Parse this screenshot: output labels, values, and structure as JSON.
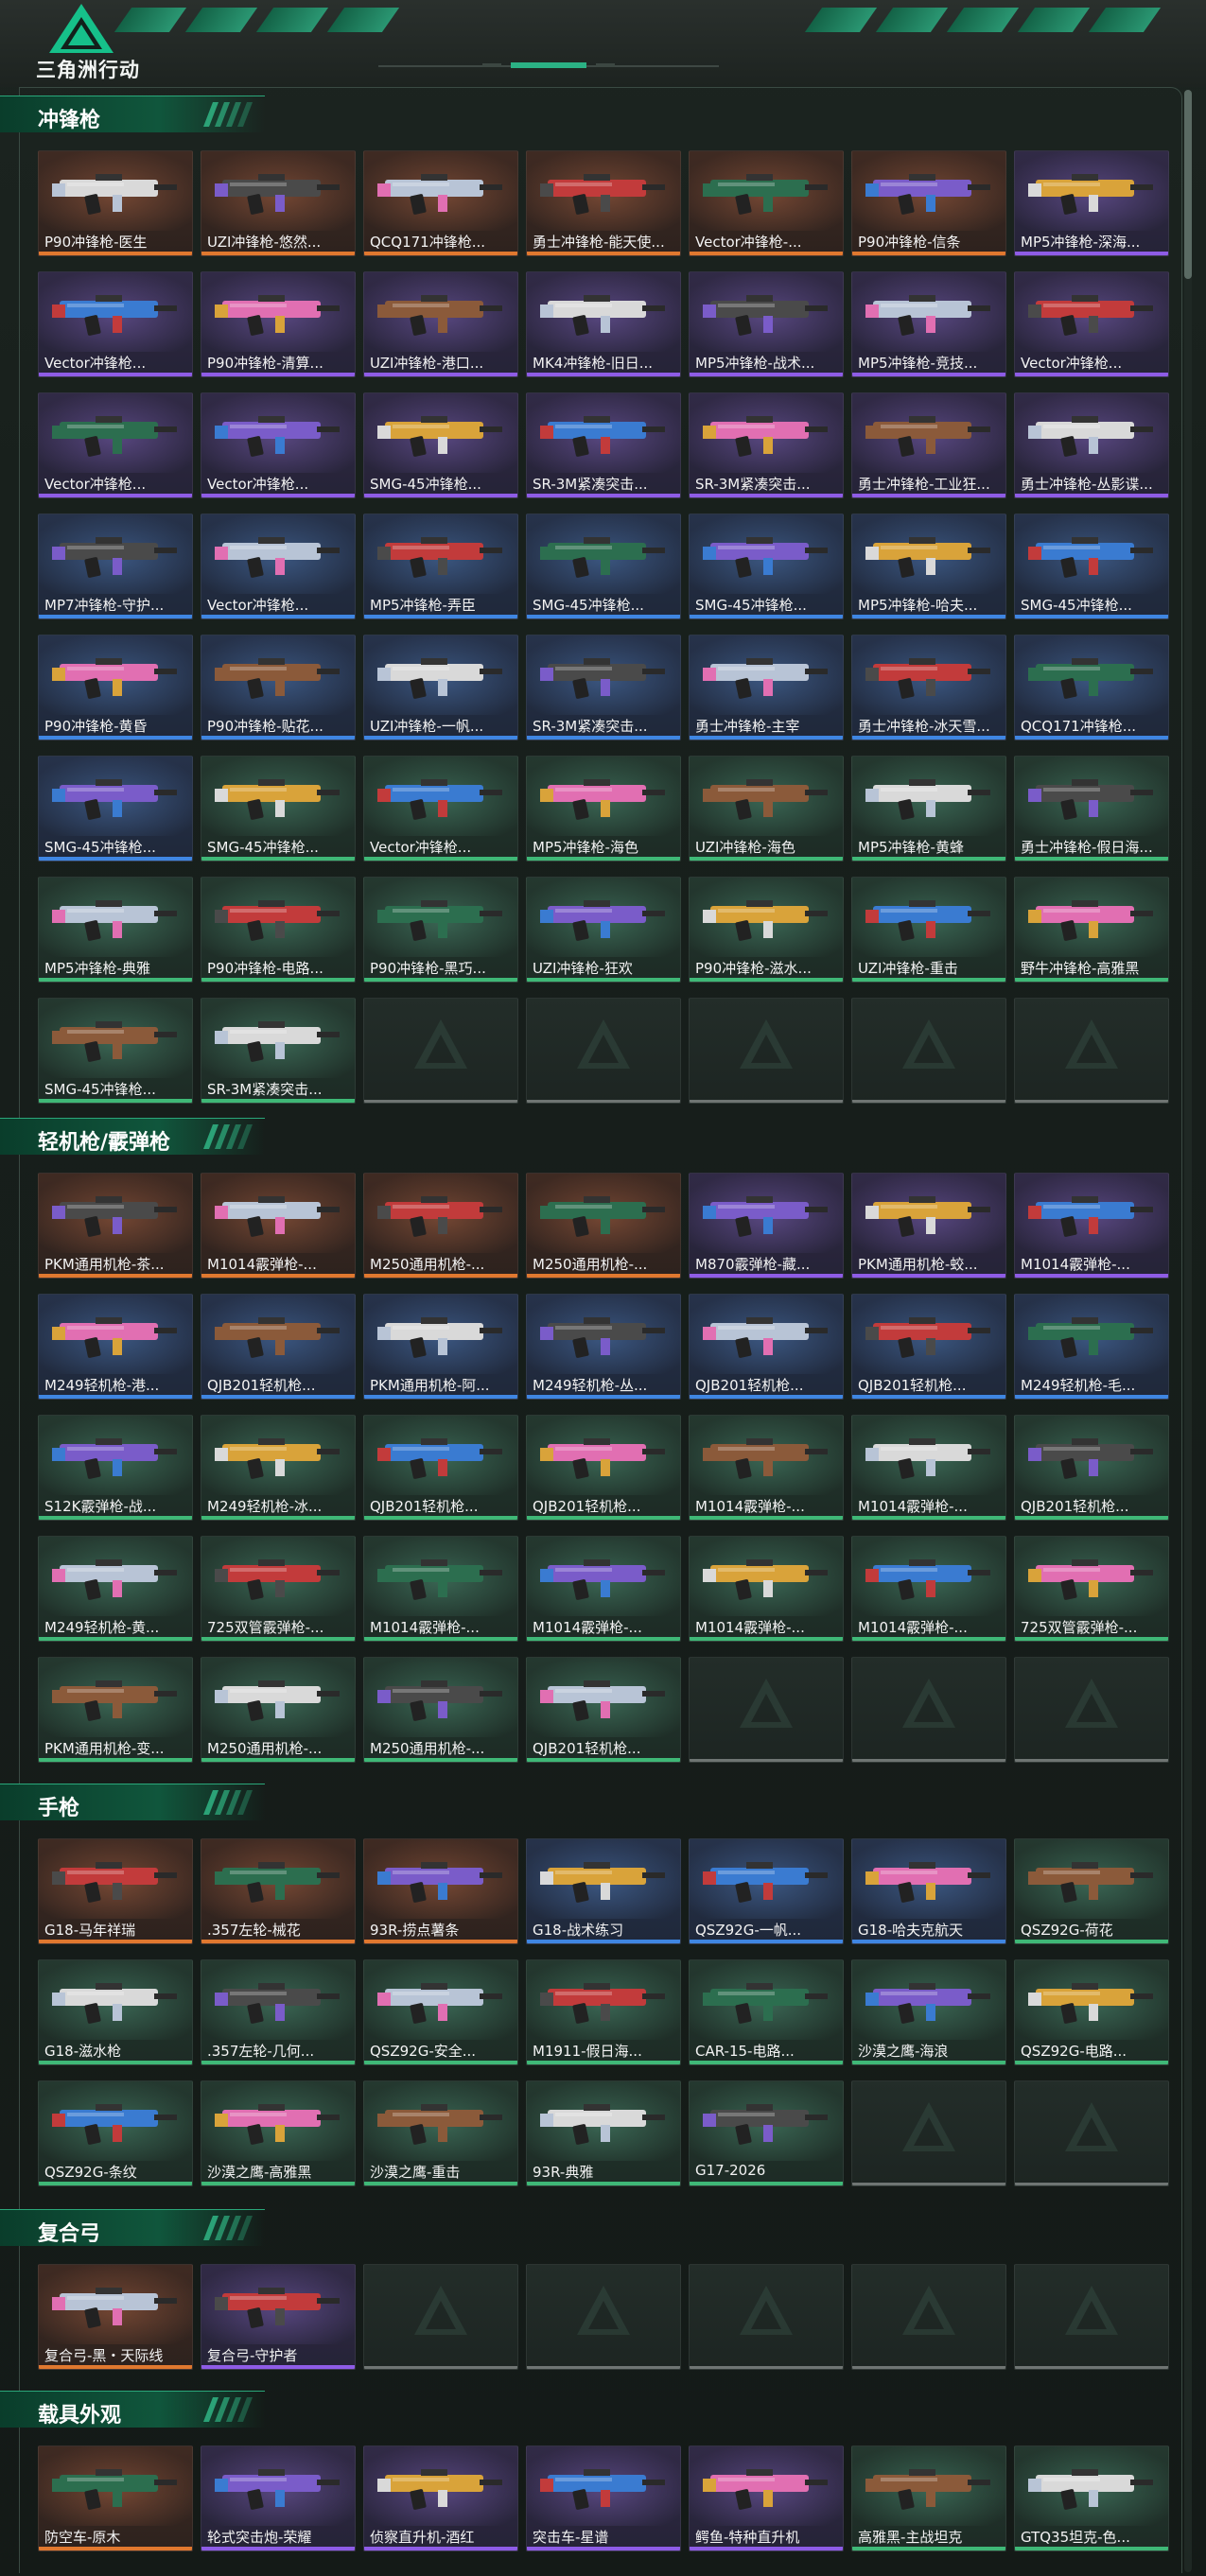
{
  "header": {
    "logo_text": "三角洲行动"
  },
  "colors": {
    "accent": "#1f9a6e",
    "legendary": "#e0782f",
    "epic": "#8e5ce6",
    "rare": "#3f86e2",
    "uncommon": "#3fb877",
    "empty": "#6f7573"
  },
  "sections": [
    {
      "title": "冲锋枪",
      "items": [
        {
          "label": "P90冲锋枪-医生",
          "rarity": "orange"
        },
        {
          "label": "UZI冲锋枪-悠然...",
          "rarity": "orange"
        },
        {
          "label": "QCQ171冲锋枪...",
          "rarity": "orange"
        },
        {
          "label": "勇士冲锋枪-能天使...",
          "rarity": "orange"
        },
        {
          "label": "Vector冲锋枪-...",
          "rarity": "orange"
        },
        {
          "label": "P90冲锋枪-信条",
          "rarity": "orange"
        },
        {
          "label": "MP5冲锋枪-深海...",
          "rarity": "purple"
        },
        {
          "label": "Vector冲锋枪...",
          "rarity": "purple"
        },
        {
          "label": "P90冲锋枪-清算...",
          "rarity": "purple"
        },
        {
          "label": "UZI冲锋枪-港口...",
          "rarity": "purple"
        },
        {
          "label": "MK4冲锋枪-旧日...",
          "rarity": "purple"
        },
        {
          "label": "MP5冲锋枪-战术...",
          "rarity": "purple"
        },
        {
          "label": "MP5冲锋枪-竞技...",
          "rarity": "purple"
        },
        {
          "label": "Vector冲锋枪...",
          "rarity": "purple"
        },
        {
          "label": "Vector冲锋枪...",
          "rarity": "purple"
        },
        {
          "label": "Vector冲锋枪...",
          "rarity": "purple"
        },
        {
          "label": "SMG-45冲锋枪...",
          "rarity": "purple"
        },
        {
          "label": "SR-3M紧凑突击...",
          "rarity": "purple"
        },
        {
          "label": "SR-3M紧凑突击...",
          "rarity": "purple"
        },
        {
          "label": "勇士冲锋枪-工业狂...",
          "rarity": "purple"
        },
        {
          "label": "勇士冲锋枪-丛影谍...",
          "rarity": "purple"
        },
        {
          "label": "MP7冲锋枪-守护...",
          "rarity": "blue"
        },
        {
          "label": "Vector冲锋枪...",
          "rarity": "blue"
        },
        {
          "label": "MP5冲锋枪-弄臣",
          "rarity": "blue"
        },
        {
          "label": "SMG-45冲锋枪...",
          "rarity": "blue"
        },
        {
          "label": "SMG-45冲锋枪...",
          "rarity": "blue"
        },
        {
          "label": "MP5冲锋枪-哈夫...",
          "rarity": "blue"
        },
        {
          "label": "SMG-45冲锋枪...",
          "rarity": "blue"
        },
        {
          "label": "P90冲锋枪-黄昏",
          "rarity": "blue"
        },
        {
          "label": "P90冲锋枪-贴花...",
          "rarity": "blue"
        },
        {
          "label": "UZI冲锋枪-一帆...",
          "rarity": "blue"
        },
        {
          "label": "SR-3M紧凑突击...",
          "rarity": "blue"
        },
        {
          "label": "勇士冲锋枪-主宰",
          "rarity": "blue"
        },
        {
          "label": "勇士冲锋枪-冰天雪...",
          "rarity": "blue"
        },
        {
          "label": "QCQ171冲锋枪...",
          "rarity": "blue"
        },
        {
          "label": "SMG-45冲锋枪...",
          "rarity": "blue"
        },
        {
          "label": "SMG-45冲锋枪...",
          "rarity": "green"
        },
        {
          "label": "Vector冲锋枪...",
          "rarity": "green"
        },
        {
          "label": "MP5冲锋枪-海色",
          "rarity": "green"
        },
        {
          "label": "UZI冲锋枪-海色",
          "rarity": "green"
        },
        {
          "label": "MP5冲锋枪-黄蜂",
          "rarity": "green"
        },
        {
          "label": "勇士冲锋枪-假日海...",
          "rarity": "green"
        },
        {
          "label": "MP5冲锋枪-典雅",
          "rarity": "green"
        },
        {
          "label": "P90冲锋枪-电路...",
          "rarity": "green"
        },
        {
          "label": "P90冲锋枪-黑巧...",
          "rarity": "green"
        },
        {
          "label": "UZI冲锋枪-狂欢",
          "rarity": "green"
        },
        {
          "label": "P90冲锋枪-滋水...",
          "rarity": "green"
        },
        {
          "label": "UZI冲锋枪-重击",
          "rarity": "green"
        },
        {
          "label": "野牛冲锋枪-高雅黑",
          "rarity": "green"
        },
        {
          "label": "SMG-45冲锋枪...",
          "rarity": "green"
        },
        {
          "label": "SR-3M紧凑突击...",
          "rarity": "green"
        },
        {
          "label": "",
          "rarity": "empty"
        },
        {
          "label": "",
          "rarity": "empty"
        },
        {
          "label": "",
          "rarity": "empty"
        },
        {
          "label": "",
          "rarity": "empty"
        },
        {
          "label": "",
          "rarity": "empty"
        }
      ]
    },
    {
      "title": "轻机枪/霰弹枪",
      "items": [
        {
          "label": "PKM通用机枪-茶...",
          "rarity": "orange"
        },
        {
          "label": "M1014霰弹枪-...",
          "rarity": "orange"
        },
        {
          "label": "M250通用机枪-...",
          "rarity": "orange"
        },
        {
          "label": "M250通用机枪-...",
          "rarity": "orange"
        },
        {
          "label": "M870霰弹枪-藏...",
          "rarity": "purple"
        },
        {
          "label": "PKM通用机枪-蛟...",
          "rarity": "purple"
        },
        {
          "label": "M1014霰弹枪-...",
          "rarity": "purple"
        },
        {
          "label": "M249轻机枪-港...",
          "rarity": "blue"
        },
        {
          "label": "QJB201轻机枪...",
          "rarity": "blue"
        },
        {
          "label": "PKM通用机枪-阿...",
          "rarity": "blue"
        },
        {
          "label": "M249轻机枪-丛...",
          "rarity": "blue"
        },
        {
          "label": "QJB201轻机枪...",
          "rarity": "blue"
        },
        {
          "label": "QJB201轻机枪...",
          "rarity": "blue"
        },
        {
          "label": "M249轻机枪-毛...",
          "rarity": "blue"
        },
        {
          "label": "S12K霰弹枪-战...",
          "rarity": "green"
        },
        {
          "label": "M249轻机枪-冰...",
          "rarity": "green"
        },
        {
          "label": "QJB201轻机枪...",
          "rarity": "green"
        },
        {
          "label": "QJB201轻机枪...",
          "rarity": "green"
        },
        {
          "label": "M1014霰弹枪-...",
          "rarity": "green"
        },
        {
          "label": "M1014霰弹枪-...",
          "rarity": "green"
        },
        {
          "label": "QJB201轻机枪...",
          "rarity": "green"
        },
        {
          "label": "M249轻机枪-黄...",
          "rarity": "green"
        },
        {
          "label": "725双管霰弹枪-...",
          "rarity": "green"
        },
        {
          "label": "M1014霰弹枪-...",
          "rarity": "green"
        },
        {
          "label": "M1014霰弹枪-...",
          "rarity": "green"
        },
        {
          "label": "M1014霰弹枪-...",
          "rarity": "green"
        },
        {
          "label": "M1014霰弹枪-...",
          "rarity": "green"
        },
        {
          "label": "725双管霰弹枪-...",
          "rarity": "green"
        },
        {
          "label": "PKM通用机枪-变...",
          "rarity": "green"
        },
        {
          "label": "M250通用机枪-...",
          "rarity": "green"
        },
        {
          "label": "M250通用机枪-...",
          "rarity": "green"
        },
        {
          "label": "QJB201轻机枪...",
          "rarity": "green"
        },
        {
          "label": "",
          "rarity": "empty"
        },
        {
          "label": "",
          "rarity": "empty"
        },
        {
          "label": "",
          "rarity": "empty"
        }
      ]
    },
    {
      "title": "手枪",
      "items": [
        {
          "label": "G18-马年祥瑞",
          "rarity": "orange"
        },
        {
          "label": ".357左轮-械花",
          "rarity": "orange"
        },
        {
          "label": "93R-捞点薯条",
          "rarity": "orange"
        },
        {
          "label": "G18-战术练习",
          "rarity": "blue"
        },
        {
          "label": "QSZ92G-一帆...",
          "rarity": "blue"
        },
        {
          "label": "G18-哈夫克航天",
          "rarity": "blue"
        },
        {
          "label": "QSZ92G-荷花",
          "rarity": "green"
        },
        {
          "label": "G18-滋水枪",
          "rarity": "green"
        },
        {
          "label": ".357左轮-几何...",
          "rarity": "green"
        },
        {
          "label": "QSZ92G-安全...",
          "rarity": "green"
        },
        {
          "label": "M1911-假日海...",
          "rarity": "green"
        },
        {
          "label": "CAR-15-电路...",
          "rarity": "green"
        },
        {
          "label": "沙漠之鹰-海浪",
          "rarity": "green"
        },
        {
          "label": "QSZ92G-电路...",
          "rarity": "green"
        },
        {
          "label": "QSZ92G-条纹",
          "rarity": "green"
        },
        {
          "label": "沙漠之鹰-高雅黑",
          "rarity": "green"
        },
        {
          "label": "沙漠之鹰-重击",
          "rarity": "green"
        },
        {
          "label": "93R-典雅",
          "rarity": "green"
        },
        {
          "label": "G17-2026",
          "rarity": "green"
        },
        {
          "label": "",
          "rarity": "empty"
        },
        {
          "label": "",
          "rarity": "empty"
        }
      ]
    },
    {
      "title": "复合弓",
      "items": [
        {
          "label": "复合弓-黑・天际线",
          "rarity": "orange"
        },
        {
          "label": "复合弓-守护者",
          "rarity": "purple"
        },
        {
          "label": "",
          "rarity": "empty"
        },
        {
          "label": "",
          "rarity": "empty"
        },
        {
          "label": "",
          "rarity": "empty"
        },
        {
          "label": "",
          "rarity": "empty"
        },
        {
          "label": "",
          "rarity": "empty"
        }
      ]
    },
    {
      "title": "载具外观",
      "items": [
        {
          "label": "防空车-原木",
          "rarity": "orange"
        },
        {
          "label": "轮式突击炮-荣耀",
          "rarity": "purple"
        },
        {
          "label": "侦察直升机-酒红",
          "rarity": "purple"
        },
        {
          "label": "突击车-星谱",
          "rarity": "purple"
        },
        {
          "label": "鳄鱼-特种直升机",
          "rarity": "purple"
        },
        {
          "label": "高雅黑-主战坦克",
          "rarity": "green"
        },
        {
          "label": "GTQ35坦克-色...",
          "rarity": "green"
        }
      ]
    }
  ]
}
